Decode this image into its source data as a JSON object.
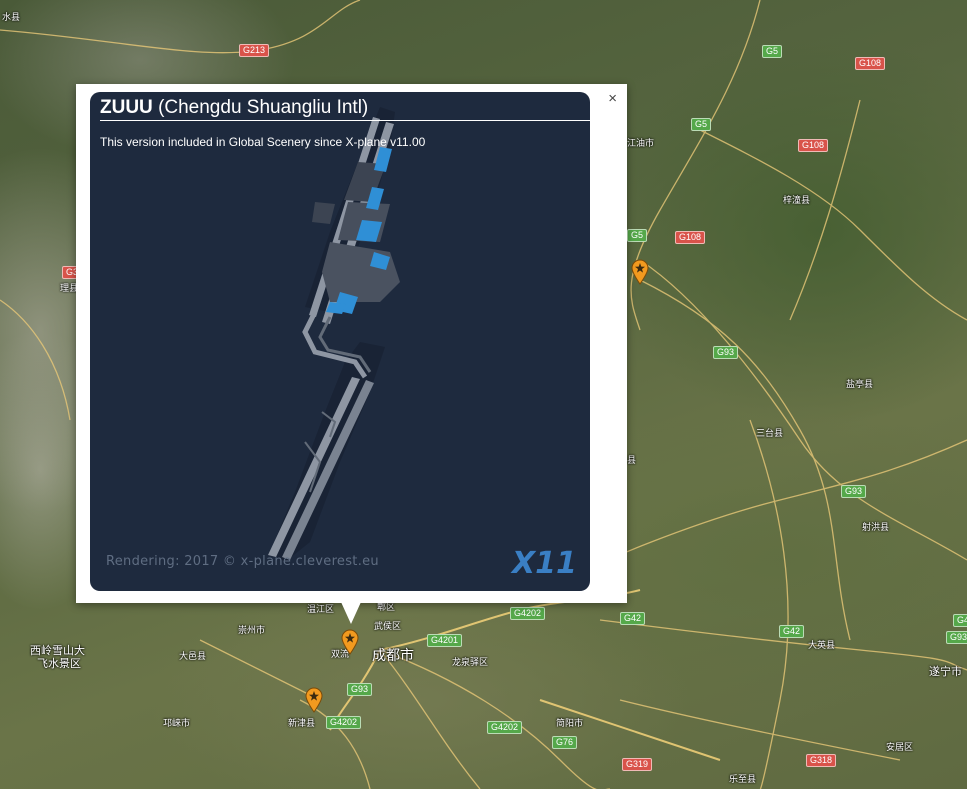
{
  "popup": {
    "title_code": "ZUUU",
    "title_name": "(Chengdu Shuangliu Intl)",
    "close_label": "×",
    "version_text": "This version included in Global Scenery since X-plane v11.00",
    "render_credit": "Rendering: 2017 © x-plane.cleverest.eu",
    "logo_text": "X11"
  },
  "highway_shields": [
    {
      "label": "G213",
      "color": "red"
    },
    {
      "label": "G5",
      "color": "green"
    },
    {
      "label": "G108",
      "color": "red"
    },
    {
      "label": "G5",
      "color": "green"
    },
    {
      "label": "G108",
      "color": "red"
    },
    {
      "label": "G5",
      "color": "green"
    },
    {
      "label": "G108",
      "color": "red"
    },
    {
      "label": "G93",
      "color": "green"
    },
    {
      "label": "G93",
      "color": "green"
    },
    {
      "label": "G4202",
      "color": "green"
    },
    {
      "label": "G42",
      "color": "green"
    },
    {
      "label": "G42",
      "color": "green"
    },
    {
      "label": "G4201",
      "color": "green"
    },
    {
      "label": "G93",
      "color": "green"
    },
    {
      "label": "G4202",
      "color": "green"
    },
    {
      "label": "G4202",
      "color": "green"
    },
    {
      "label": "G76",
      "color": "green"
    },
    {
      "label": "G319",
      "color": "red"
    },
    {
      "label": "G318",
      "color": "red"
    },
    {
      "label": "G93",
      "color": "green"
    },
    {
      "label": "G4",
      "color": "green"
    },
    {
      "label": "G3",
      "color": "red"
    }
  ],
  "places": [
    "水县",
    "江油市",
    "梓潼县",
    "盐亭县",
    "三台县",
    "射洪县",
    "大英县",
    "遂宁市",
    "西岭雪山大",
    "飞水景区",
    "崇州市",
    "大邑县",
    "温江区",
    "武侯区",
    "成都市",
    "双流",
    "龙泉驿区",
    "新津县",
    "邛崃市",
    "简阳市",
    "乐至县",
    "安居区",
    "理县",
    "县",
    "郫区"
  ],
  "colors": {
    "card_bg": "#1e2a3e",
    "marker": "#f29a1f",
    "terminal": "#2f8fd6"
  }
}
